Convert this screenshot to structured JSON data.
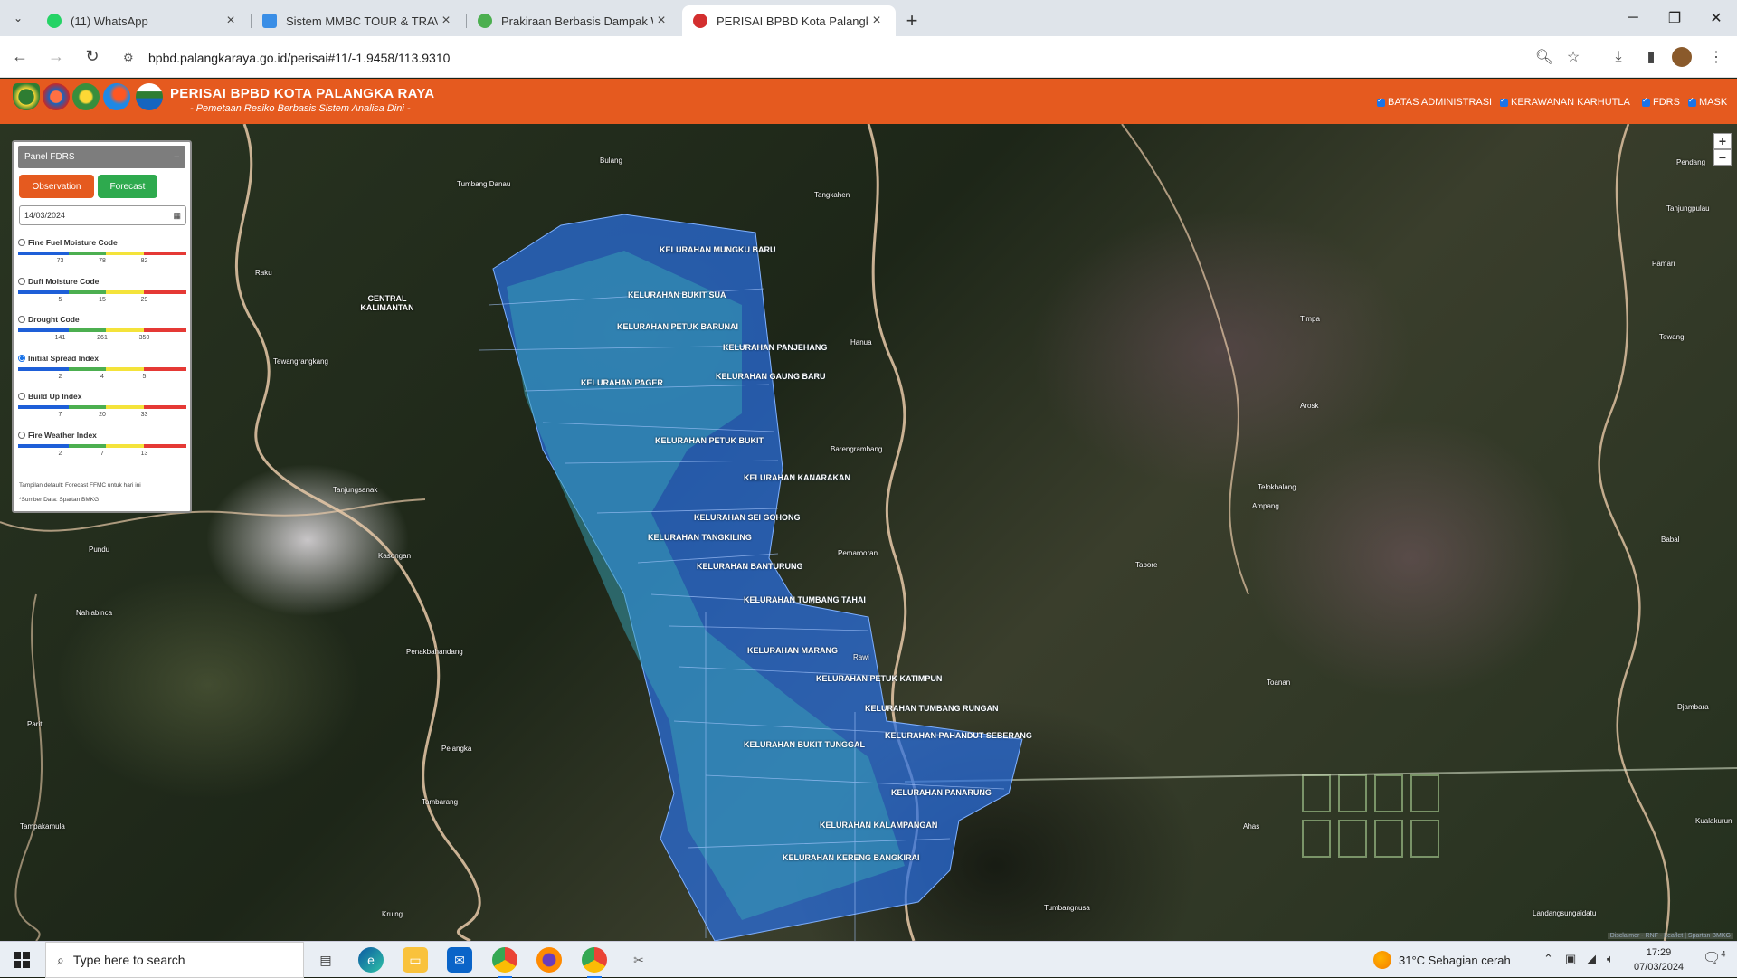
{
  "browser": {
    "tabs": [
      {
        "title": "(11) WhatsApp",
        "favicon_color": "#25d366",
        "active": false
      },
      {
        "title": "Sistem MMBC TOUR & TRAVEL",
        "favicon_color": "#3a8ee6",
        "active": false
      },
      {
        "title": "Prakiraan Berbasis Dampak Wil",
        "favicon_color": "#4caf50",
        "active": false
      },
      {
        "title": "PERISAI BPBD Kota Palangka Ra",
        "favicon_color": "#d32f2f",
        "active": true
      }
    ],
    "new_tab_symbol": "+",
    "url": "bpbd.palangkaraya.go.id/perisai#11/-1.9458/113.9310"
  },
  "site": {
    "title": "PERISAI BPBD KOTA PALANGKA RAYA",
    "subtitle": "- Pemetaan Resiko Berbasis Sistem Analisa Dini -",
    "header_color": "#e55a1f",
    "layers": [
      {
        "label": "BATAS ADMINISTRASI",
        "checked": true
      },
      {
        "label": "KERAWANAN KARHUTLA",
        "checked": true
      },
      {
        "label": "FDRS",
        "checked": true
      },
      {
        "label": "MASK",
        "checked": true
      }
    ]
  },
  "panel": {
    "title": "Panel FDRS",
    "collapse_symbol": "–",
    "observation_label": "Observation",
    "forecast_label": "Forecast",
    "date": "14/03/2024",
    "indices": [
      {
        "label": "Fine Fuel Moisture Code",
        "ticks": [
          "73",
          "78",
          "82"
        ],
        "selected": false
      },
      {
        "label": "Duff Moisture Code",
        "ticks": [
          "5",
          "15",
          "29"
        ],
        "selected": false
      },
      {
        "label": "Drought Code",
        "ticks": [
          "141",
          "261",
          "350"
        ],
        "selected": false
      },
      {
        "label": "Initial Spread Index",
        "ticks": [
          "2",
          "4",
          "5"
        ],
        "selected": true
      },
      {
        "label": "Build Up Index",
        "ticks": [
          "7",
          "20",
          "33"
        ],
        "selected": false
      },
      {
        "label": "Fire Weather Index",
        "ticks": [
          "2",
          "7",
          "13"
        ],
        "selected": false
      }
    ],
    "note_default": "Tampilan default: Forecast FFMC untuk hari ini",
    "note_source": "*Sumber Data: Spartan BMKG",
    "scale_colors": [
      "#1e5fd8",
      "#4caf50",
      "#f4e33a",
      "#e53935"
    ]
  },
  "map": {
    "zoom_in": "+",
    "zoom_out": "−",
    "attribution": "Disclaimer - RNF - Leaflet | Spartan BMKG",
    "kelurahan": [
      "KELURAHAN MUNGKU BARU",
      "KELURAHAN BUKIT SUA",
      "KELURAHAN PETUK BARUNAI",
      "KELURAHAN PANJEHANG",
      "KELURAHAN PAGER",
      "KELURAHAN GAUNG BARU",
      "KELURAHAN PETUK BUKIT",
      "KELURAHAN KANARAKAN",
      "KELURAHAN SEI GOHONG",
      "KELURAHAN TANGKILING",
      "KELURAHAN BANTURUNG",
      "KELURAHAN TUMBANG TAHAI",
      "KELURAHAN MARANG",
      "KELURAHAN PETUK KATIMPUN",
      "KELURAHAN TUMBANG RUNGAN",
      "KELURAHAN PAHANDUT SEBERANG",
      "KELURAHAN BUKIT TUNGGAL",
      "KELURAHAN PANARUNG",
      "KELURAHAN KALAMPANGAN",
      "KELURAHAN KERENG BANGKIRAI"
    ],
    "places": [
      "Bulang",
      "Tumbang Danau",
      "Tangkahen",
      "Raku",
      "CENTRAL KALIMANTAN",
      "Tewangrangkang",
      "Hanua",
      "Timpa",
      "Arosk",
      "Barengrambang",
      "Tanjungsanak",
      "Kasongan",
      "Pundu",
      "Pemarooran",
      "Ampang",
      "Tabore",
      "Telokbalang",
      "Nahiabinca",
      "Penakbahandang",
      "Rawi",
      "Toanan",
      "Parit",
      "Pelangka",
      "Tambarang",
      "Tampakamula",
      "Kruing",
      "Tumbangnusa",
      "Ahas",
      "Landangsungaidatu",
      "Pendang",
      "Tanjungpulau",
      "Pamari",
      "Tewang",
      "Babal",
      "Djambara",
      "Kualakurun"
    ]
  },
  "taskbar": {
    "search_placeholder": "Type here to search",
    "weather": "31°C  Sebagian cerah",
    "time": "17:29",
    "date": "07/03/2024",
    "notifications": "4"
  }
}
